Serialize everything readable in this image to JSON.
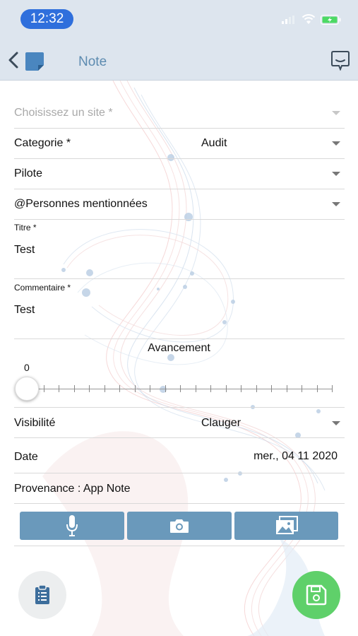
{
  "status_bar": {
    "time": "12:32"
  },
  "nav": {
    "title": "Note"
  },
  "form": {
    "site": {
      "placeholder": "Choisissez un site *"
    },
    "categorie": {
      "label": "Categorie *",
      "value": "Audit"
    },
    "pilote": {
      "label": "Pilote"
    },
    "personnes": {
      "label": "@Personnes mentionnées"
    },
    "titre": {
      "label": "Titre *",
      "value": "Test"
    },
    "commentaire": {
      "label": "Commentaire *",
      "value": "Test"
    },
    "avancement": {
      "label": "Avancement",
      "value": "0",
      "level": 0
    },
    "visibilite": {
      "label": "Visibilité",
      "value": "Clauger"
    },
    "date": {
      "label": "Date",
      "value": "mer., 04 11 2020"
    },
    "provenance": {
      "text": "Provenance : App Note"
    }
  },
  "colors": {
    "accent": "#6a99bb",
    "nav_bg": "#dde5ee",
    "time_pill": "#2f6fdc",
    "save_fab": "#5fd06a",
    "nav_title": "#5d8bb0"
  },
  "icons": {
    "media_buttons": [
      "microphone-icon",
      "camera-icon",
      "gallery-icon"
    ],
    "left_fab": "clipboard-icon",
    "right_fab": "save-icon"
  }
}
